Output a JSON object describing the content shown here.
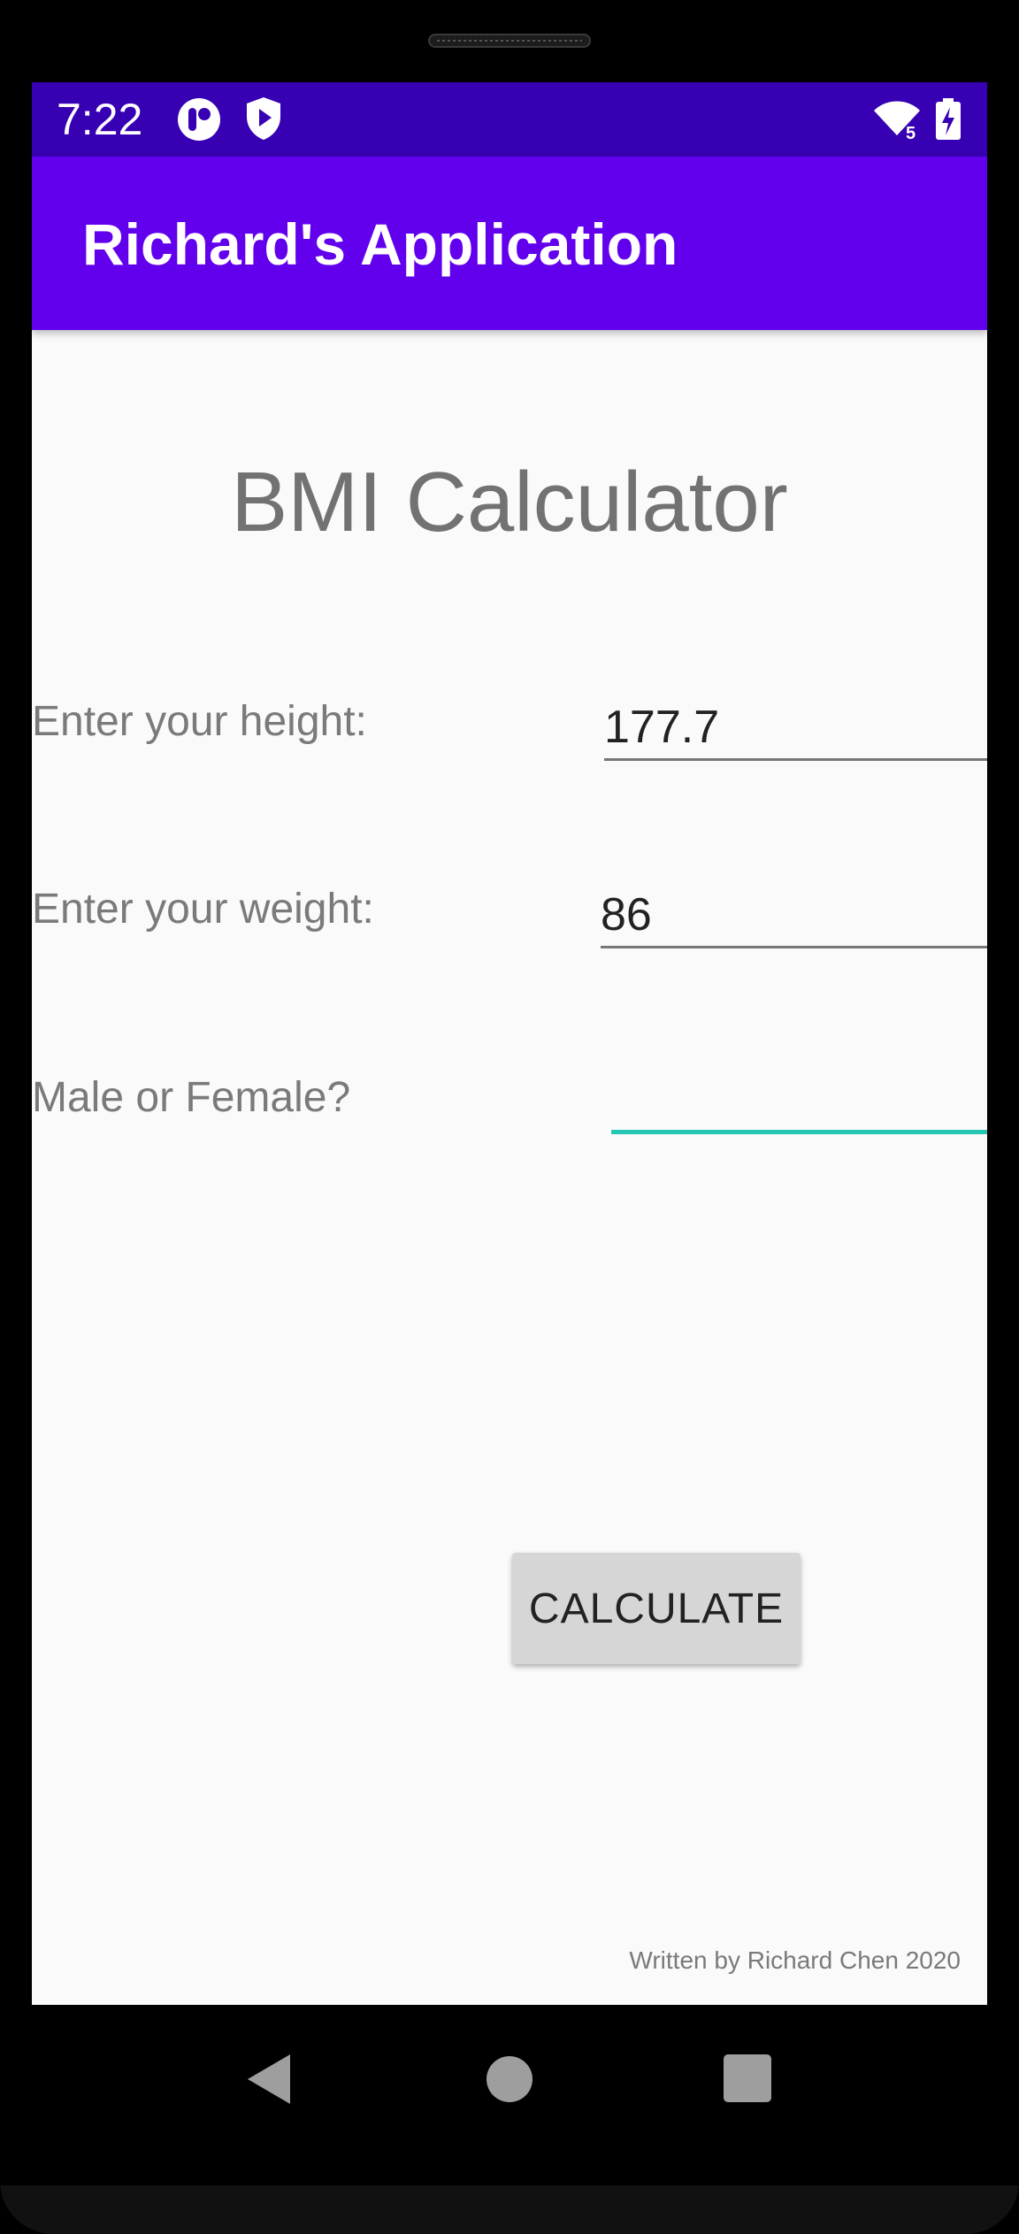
{
  "status_bar": {
    "time": "7:22",
    "icons": [
      "circle-app-icon",
      "shield-play-icon",
      "wifi-icon",
      "battery-charging-icon"
    ],
    "wifi_badge": "5",
    "background": "#3700b3"
  },
  "app_bar": {
    "title": "Richard's Application",
    "background": "#6200ee"
  },
  "main": {
    "title": "BMI Calculator",
    "height_label": "Enter your height:",
    "height_value": "177.7",
    "weight_label": "Enter your weight:",
    "weight_value": "86",
    "gender_label": "Male or Female?",
    "gender_value": "",
    "focus_color": "#26c6b5",
    "calculate_label": "CALCULATE",
    "footer": "Written by Richard Chen 2020"
  },
  "nav_bar": {
    "icons": [
      "back-icon",
      "home-icon",
      "recents-icon"
    ]
  }
}
